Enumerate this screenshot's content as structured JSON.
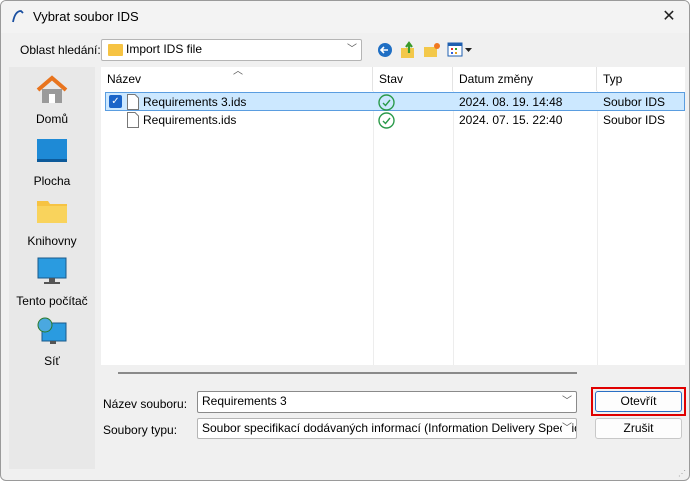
{
  "window": {
    "title": "Vybrat soubor IDS",
    "close_label": "✕"
  },
  "lookin": {
    "label": "Oblast hledání:",
    "value": "Import IDS file"
  },
  "toolbar": {
    "icons": [
      "back-icon",
      "up-folder-icon",
      "new-folder-icon",
      "view-menu-icon"
    ]
  },
  "places": [
    {
      "label": "Domů",
      "icon": "home-icon"
    },
    {
      "label": "Plocha",
      "icon": "desktop-icon"
    },
    {
      "label": "Knihovny",
      "icon": "libraries-icon"
    },
    {
      "label": "Tento počítač",
      "icon": "computer-icon"
    },
    {
      "label": "Síť",
      "icon": "network-icon"
    }
  ],
  "columns": [
    "Název",
    "Stav",
    "Datum změny",
    "Typ"
  ],
  "files": [
    {
      "name": "Requirements 3.ids",
      "status": "synced",
      "date": "2024. 08. 19. 14:48",
      "type": "Soubor IDS",
      "selected": true
    },
    {
      "name": "Requirements.ids",
      "status": "synced",
      "date": "2024. 07. 15. 22:40",
      "type": "Soubor IDS",
      "selected": false
    }
  ],
  "filename": {
    "label": "Název souboru:",
    "value": "Requirements 3"
  },
  "filetype": {
    "label": "Soubory typu:",
    "value": "Soubor specifikací dodávaných informací (Information Delivery Specificatio"
  },
  "buttons": {
    "open": "Otevřít",
    "cancel": "Zrušit"
  },
  "colors": {
    "highlight": "#e00000",
    "selection": "#cce8ff"
  }
}
